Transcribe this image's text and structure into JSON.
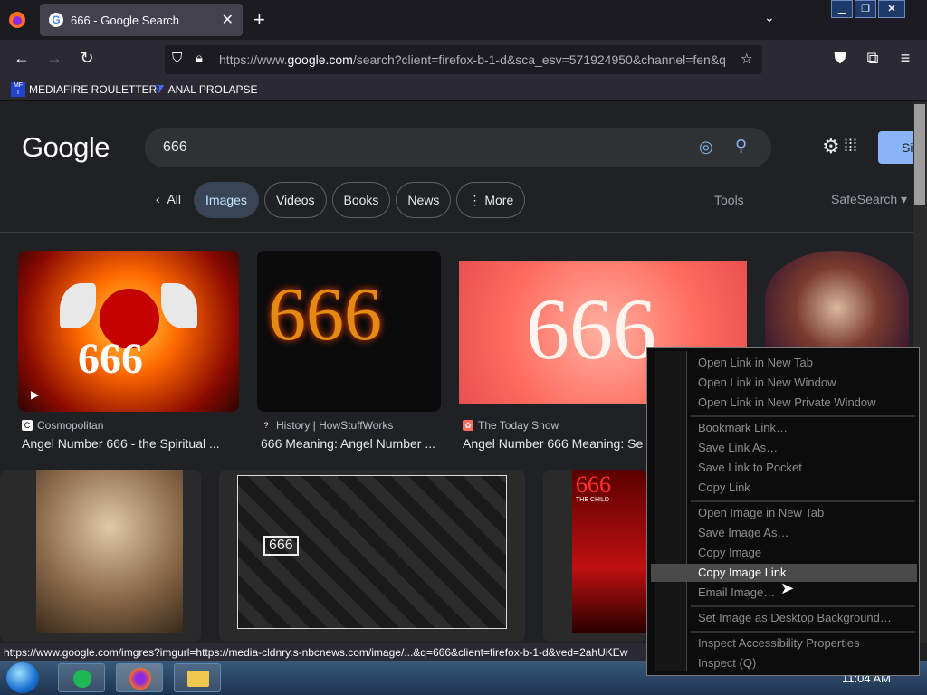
{
  "browser": {
    "tab_title": "666 - Google Search",
    "url_prefix": "https://www.",
    "url_domain": "google.com",
    "url_rest": "/search?client=firefox-b-1-d&sca_esv=571924950&channel=fen&q",
    "bookmarks": [
      "MEDIAFIRE ROULETTER",
      "ANAL PROLAPSE"
    ],
    "bookmark_icon_text": "MF T"
  },
  "google": {
    "logo": "Google",
    "query": "666",
    "signin_label": "Si",
    "tabs": [
      "All",
      "Images",
      "Videos",
      "Books",
      "News",
      "More"
    ],
    "tools": "Tools",
    "safesearch": "SafeSearch"
  },
  "results": [
    {
      "source": "Cosmopolitan",
      "title": "Angel Number 666 - the Spiritual ..."
    },
    {
      "source": "History | HowStuffWorks",
      "title": "666 Meaning: Angel Number ..."
    },
    {
      "source": "The Today Show",
      "title": "Angel Number 666 Meaning: Se"
    }
  ],
  "image_text": {
    "r1": "666",
    "r2": "666",
    "r3": "666",
    "r5": "666",
    "r6": "666",
    "r6_sub": "THE CHILD"
  },
  "status_url": "https://www.google.com/imgres?imgurl=https://media-cldnry.s-nbcnews.com/image/...&q=666&client=firefox-b-1-d&ved=2ahUKEw",
  "context_menu": {
    "items": [
      "Open Link in New Tab",
      "Open Link in New Window",
      "Open Link in New Private Window",
      "Bookmark Link…",
      "Save Link As…",
      "Save Link to Pocket",
      "Copy Link",
      "Open Image in New Tab",
      "Save Image As…",
      "Copy Image",
      "Copy Image Link",
      "Email Image…",
      "Set Image as Desktop Background…",
      "Inspect Accessibility Properties",
      "Inspect (Q)"
    ],
    "highlighted": "Copy Image Link"
  },
  "taskbar": {
    "clock": "11:04 AM"
  },
  "colors": {
    "accent": "#8ab4f8",
    "page_bg": "#202124",
    "chip_active": "#394457"
  }
}
